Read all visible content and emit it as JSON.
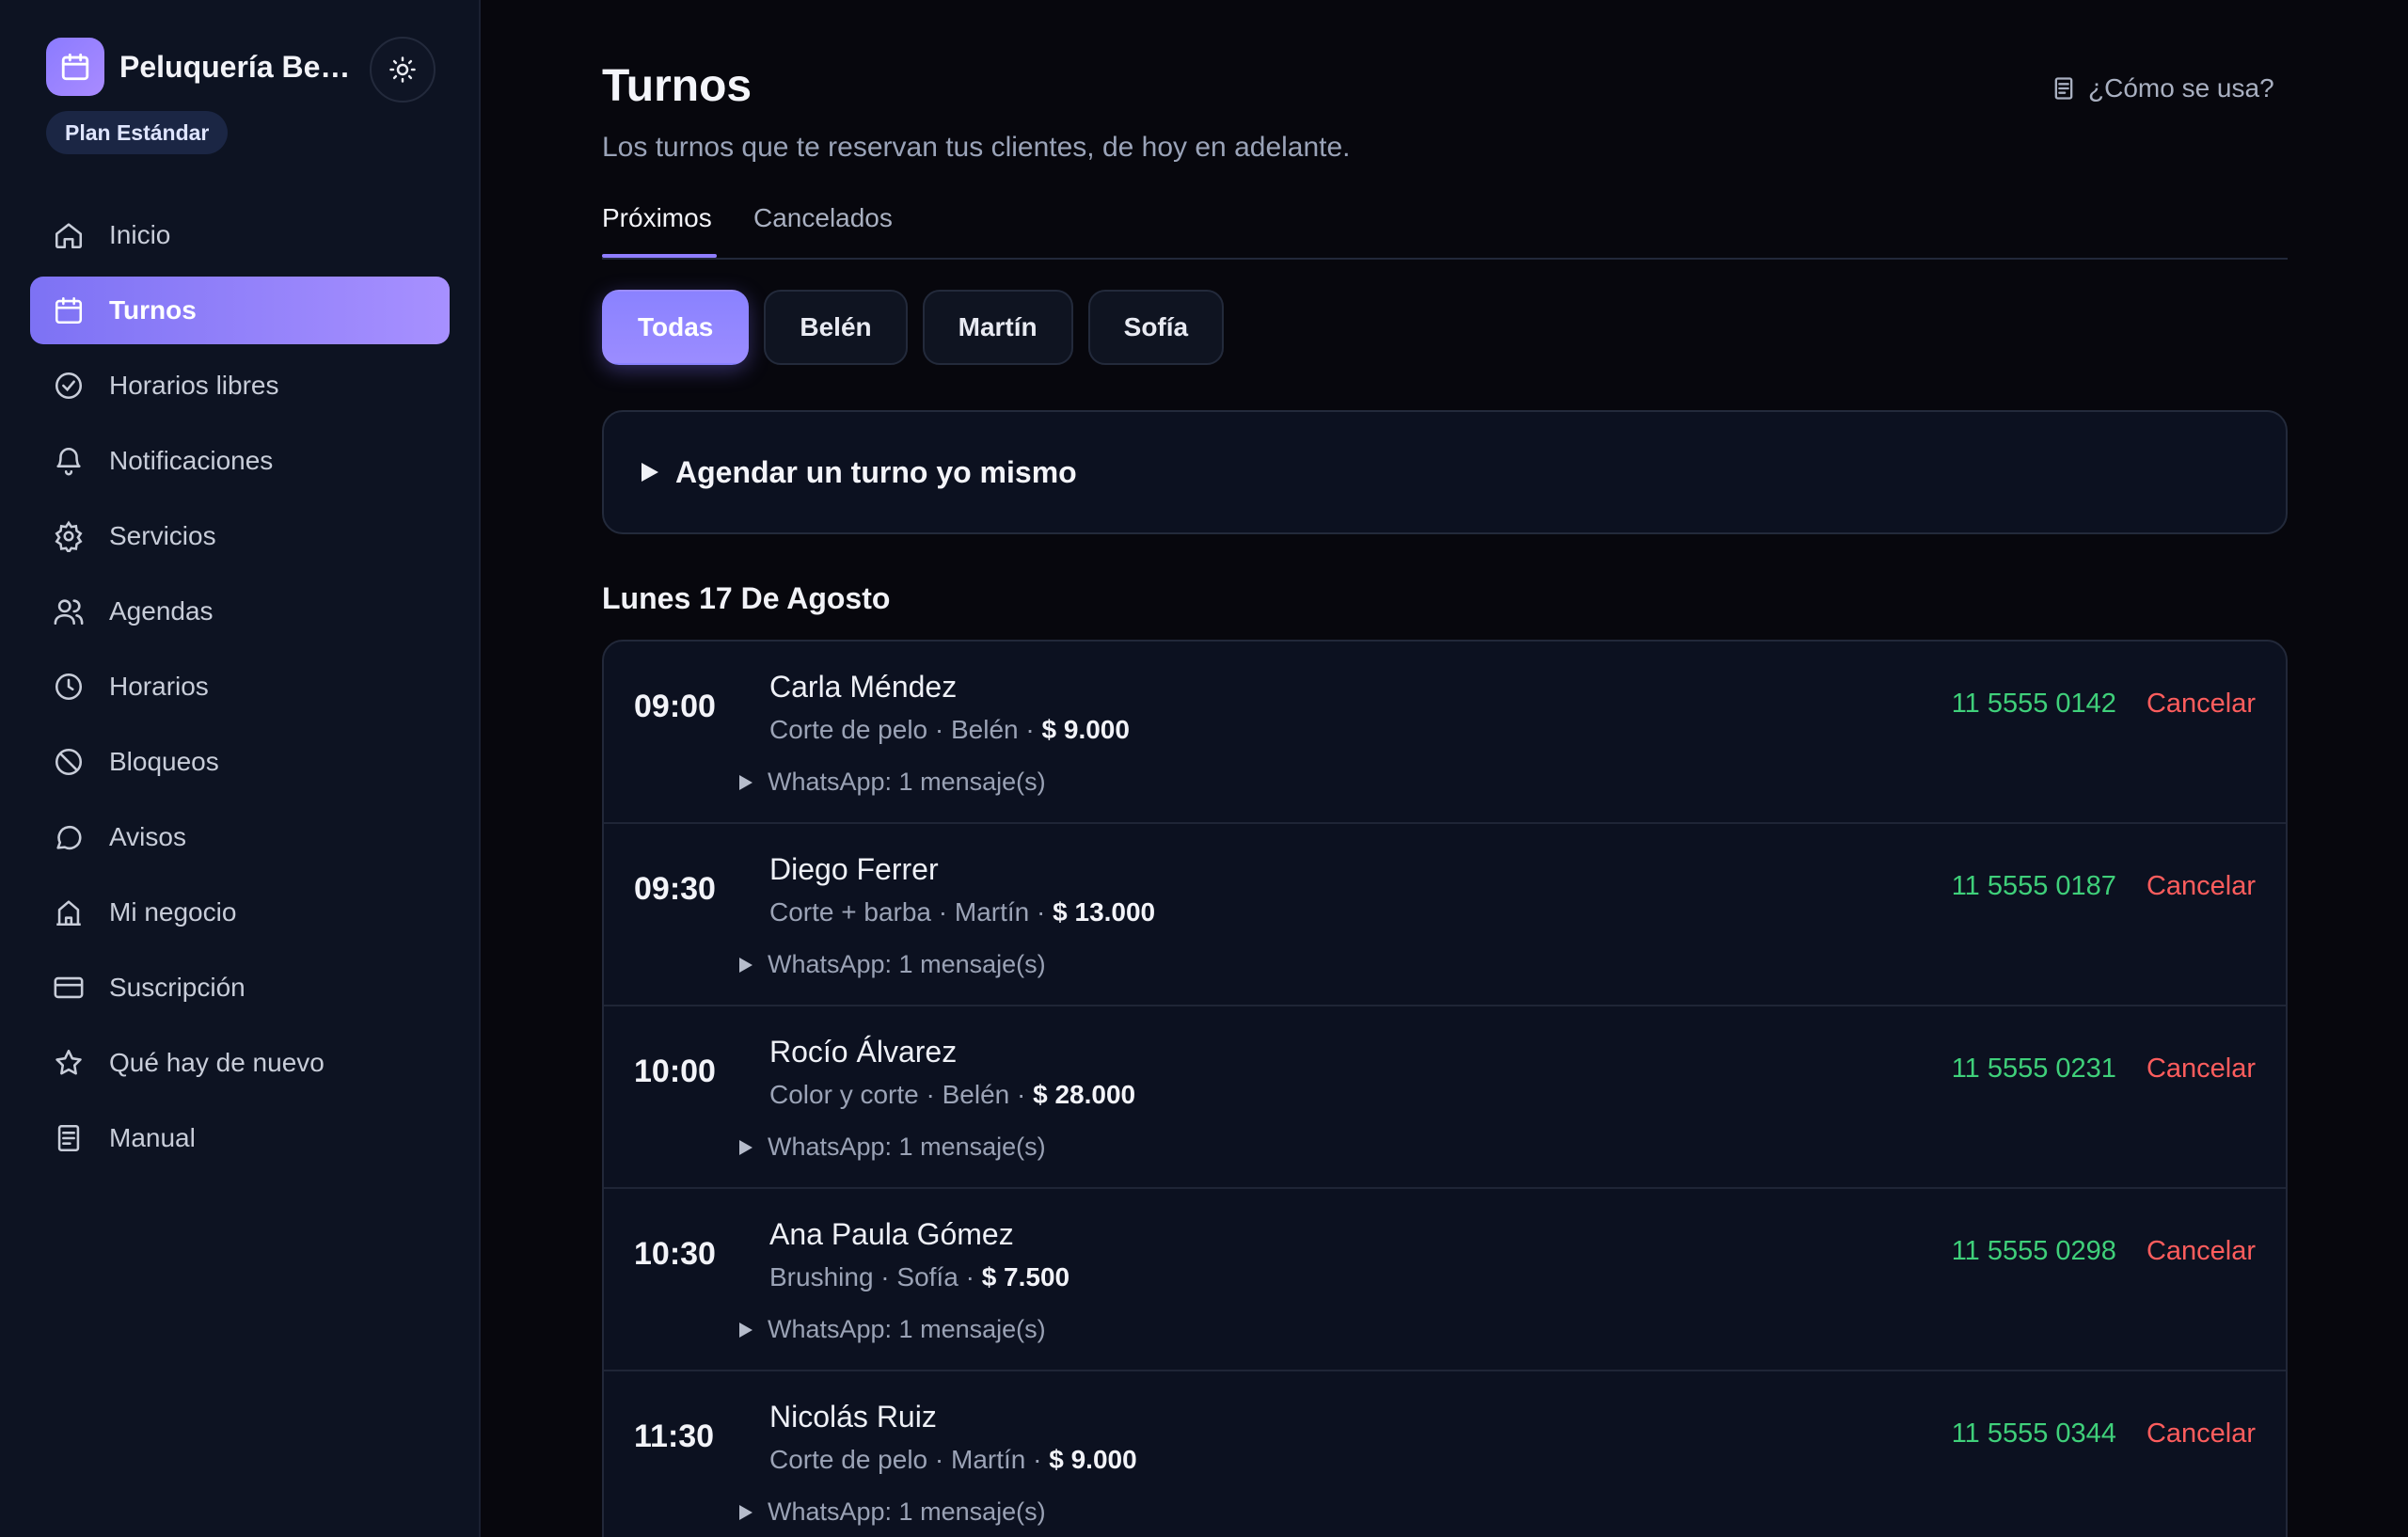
{
  "sidebar": {
    "brand_name": "Peluquería Belén",
    "plan": "Plan Estándar",
    "items": [
      {
        "label": "Inicio",
        "icon": "home-icon"
      },
      {
        "label": "Turnos",
        "icon": "calendar-icon",
        "active": true
      },
      {
        "label": "Horarios libres",
        "icon": "check-circle-icon"
      },
      {
        "label": "Notificaciones",
        "icon": "bell-icon"
      },
      {
        "label": "Servicios",
        "icon": "gear-icon"
      },
      {
        "label": "Agendas",
        "icon": "users-icon"
      },
      {
        "label": "Horarios",
        "icon": "clock-icon"
      },
      {
        "label": "Bloqueos",
        "icon": "ban-icon"
      },
      {
        "label": "Avisos",
        "icon": "chat-bubble-icon"
      },
      {
        "label": "Mi negocio",
        "icon": "building-icon"
      },
      {
        "label": "Suscripción",
        "icon": "credit-card-icon"
      },
      {
        "label": "Qué hay de nuevo",
        "icon": "star-icon"
      },
      {
        "label": "Manual",
        "icon": "document-icon"
      }
    ]
  },
  "header": {
    "title": "Turnos",
    "subtitle": "Los turnos que te reservan tus clientes, de hoy en adelante.",
    "help_label": "¿Cómo se usa?"
  },
  "tabs": [
    {
      "label": "Próximos",
      "active": true
    },
    {
      "label": "Cancelados",
      "active": false
    }
  ],
  "filters": [
    {
      "label": "Todas",
      "active": true
    },
    {
      "label": "Belén",
      "active": false
    },
    {
      "label": "Martín",
      "active": false
    },
    {
      "label": "Sofía",
      "active": false
    }
  ],
  "schedule_self_label": "Agendar un turno yo mismo",
  "day_heading": "Lunes 17 De Agosto",
  "appointments": [
    {
      "time": "09:00",
      "client": "Carla Méndez",
      "service": "Corte de pelo",
      "staff": "Belén",
      "price": "$ 9.000",
      "whatsapp": "WhatsApp: 1 mensaje(s)",
      "phone": "11 5555 0142",
      "cancel": "Cancelar"
    },
    {
      "time": "09:30",
      "client": "Diego Ferrer",
      "service": "Corte + barba",
      "staff": "Martín",
      "price": "$ 13.000",
      "whatsapp": "WhatsApp: 1 mensaje(s)",
      "phone": "11 5555 0187",
      "cancel": "Cancelar"
    },
    {
      "time": "10:00",
      "client": "Rocío Álvarez",
      "service": "Color y corte",
      "staff": "Belén",
      "price": "$ 28.000",
      "whatsapp": "WhatsApp: 1 mensaje(s)",
      "phone": "11 5555 0231",
      "cancel": "Cancelar"
    },
    {
      "time": "10:30",
      "client": "Ana Paula Gómez",
      "service": "Brushing",
      "staff": "Sofía",
      "price": "$ 7.500",
      "whatsapp": "WhatsApp: 1 mensaje(s)",
      "phone": "11 5555 0298",
      "cancel": "Cancelar"
    },
    {
      "time": "11:30",
      "client": "Nicolás Ruiz",
      "service": "Corte de pelo",
      "staff": "Martín",
      "price": "$ 9.000",
      "whatsapp": "WhatsApp: 1 mensaje(s)",
      "phone": "11 5555 0344",
      "cancel": "Cancelar"
    }
  ],
  "colors": {
    "accent": "#8f7dff",
    "phone": "#3fd07a",
    "cancel": "#ff5d5d"
  }
}
